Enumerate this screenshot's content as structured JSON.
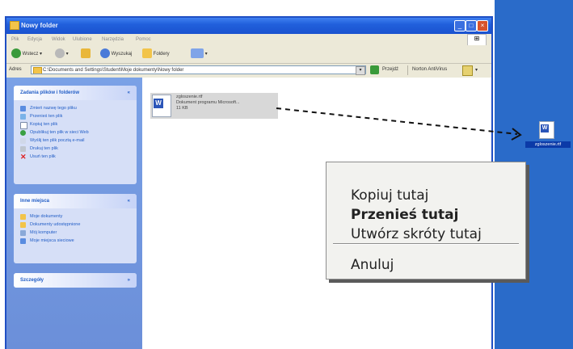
{
  "window": {
    "title": "Nowy folder",
    "controls": [
      "_",
      "□",
      "×"
    ]
  },
  "menubar": [
    "Plik",
    "Edycja",
    "Widok",
    "Ulubione",
    "Narzędzia",
    "Pomoc"
  ],
  "toolbar": {
    "back_label": "Wstecz",
    "search_label": "Wyszukaj",
    "folders_label": "Foldery"
  },
  "addressbar": {
    "label": "Adres",
    "path": "C:\\Documents and Settings\\Student\\Moje dokumenty\\Nowy folder",
    "go_label": "Przejdź",
    "norton_label": "Norton AntiVirus"
  },
  "sidepane": {
    "tasks": {
      "title": "Zadania plików i folderów",
      "items": [
        "Zmień nazwę tego pliku",
        "Przenieś ten plik",
        "Kopiuj ten plik",
        "Opublikuj ten plik w sieci Web",
        "Wyślij ten plik pocztą e-mail",
        "Drukuj ten plik",
        "Usuń ten plik"
      ]
    },
    "places": {
      "title": "Inne miejsca",
      "items": [
        "Moje dokumenty",
        "Dokumenty udostępnione",
        "Mój komputer",
        "Moje miejsca sieciowe"
      ]
    },
    "details": {
      "title": "Szczegóły"
    }
  },
  "file": {
    "name": "zgloszenie.rtf",
    "type": "Dokument programu Microsoft...",
    "size": "11 KB"
  },
  "desktop_icon": {
    "name": "zgloszenie.rtf"
  },
  "context_menu": {
    "items": [
      "Kopiuj tutaj",
      "Przenieś tutaj",
      "Utwórz skróty tutaj"
    ],
    "cancel": "Anuluj"
  },
  "colors": {
    "titlebar": "#2160dc",
    "desktop": "#2a6bc9",
    "sidepane": "#6b8fd9"
  }
}
